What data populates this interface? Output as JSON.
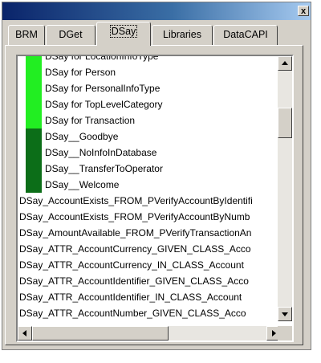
{
  "window": {
    "close_glyph": "x"
  },
  "tabs": [
    {
      "label": "BRM",
      "active": false
    },
    {
      "label": "DGet",
      "active": false
    },
    {
      "label": "DSay",
      "active": true
    },
    {
      "label": "Libraries",
      "active": false
    },
    {
      "label": "DataCAPI",
      "active": false
    }
  ],
  "list": {
    "items": [
      {
        "label": "DSay for LocationInfoType",
        "strip": "bright"
      },
      {
        "label": "DSay for Person",
        "strip": "bright"
      },
      {
        "label": "DSay for PersonalInfoType",
        "strip": "bright"
      },
      {
        "label": "DSay for TopLevelCategory",
        "strip": "bright"
      },
      {
        "label": "DSay for Transaction",
        "strip": "bright"
      },
      {
        "label": "DSay__Goodbye",
        "strip": "dark"
      },
      {
        "label": "DSay__NoInfoInDatabase",
        "strip": "dark"
      },
      {
        "label": "DSay__TransferToOperator",
        "strip": "dark"
      },
      {
        "label": "DSay__Welcome",
        "strip": "dark"
      },
      {
        "label": "DSay_AccountExists_FROM_PVerifyAccountByIdentifi",
        "strip": "none"
      },
      {
        "label": "DSay_AccountExists_FROM_PVerifyAccountByNumb",
        "strip": "none"
      },
      {
        "label": "DSay_AmountAvailable_FROM_PVerifyTransactionAn",
        "strip": "none"
      },
      {
        "label": "DSay_ATTR_AccountCurrency_GIVEN_CLASS_Acco",
        "strip": "none"
      },
      {
        "label": "DSay_ATTR_AccountCurrency_IN_CLASS_Account",
        "strip": "none"
      },
      {
        "label": "DSay_ATTR_AccountIdentifier_GIVEN_CLASS_Acco",
        "strip": "none"
      },
      {
        "label": "DSay_ATTR_AccountIdentifier_IN_CLASS_Account",
        "strip": "none"
      },
      {
        "label": "DSay_ATTR_AccountNumber_GIVEN_CLASS_Acco",
        "strip": "none"
      }
    ]
  },
  "colors": {
    "strip_bright": "#22ee22",
    "strip_dark": "#0c6e18",
    "titlebar_start": "#0a246a",
    "titlebar_end": "#a6caf0"
  },
  "scroll": {
    "vertical_position_fraction": 0.18,
    "horizontal_position_fraction": 0.0
  }
}
